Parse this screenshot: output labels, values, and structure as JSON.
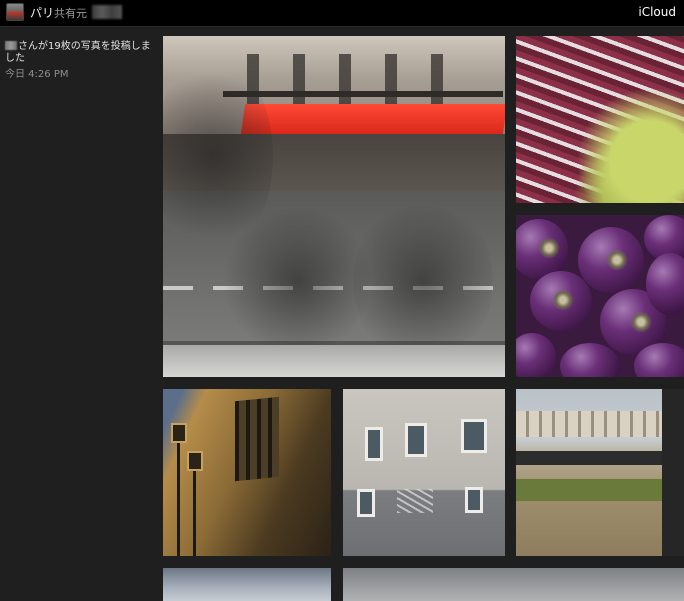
{
  "header": {
    "album_title": "パリ",
    "owner_label": "共有元",
    "app_name": "iCloud"
  },
  "activity": {
    "post_text": "さんが19枚の写真を投稿しました",
    "post_time": "今日 4:26 PM"
  },
  "colors": {
    "background": "#1f1f1f",
    "topbar": "#000000",
    "awning": "#e8321f"
  },
  "photos": [
    {
      "subject": "street-from-above"
    },
    {
      "subject": "radicchio"
    },
    {
      "subject": "eggplants"
    },
    {
      "subject": "building-lamps"
    },
    {
      "subject": "gray-building"
    },
    {
      "subject": "window-view"
    },
    {
      "subject": "sky"
    },
    {
      "subject": "overcast"
    }
  ]
}
